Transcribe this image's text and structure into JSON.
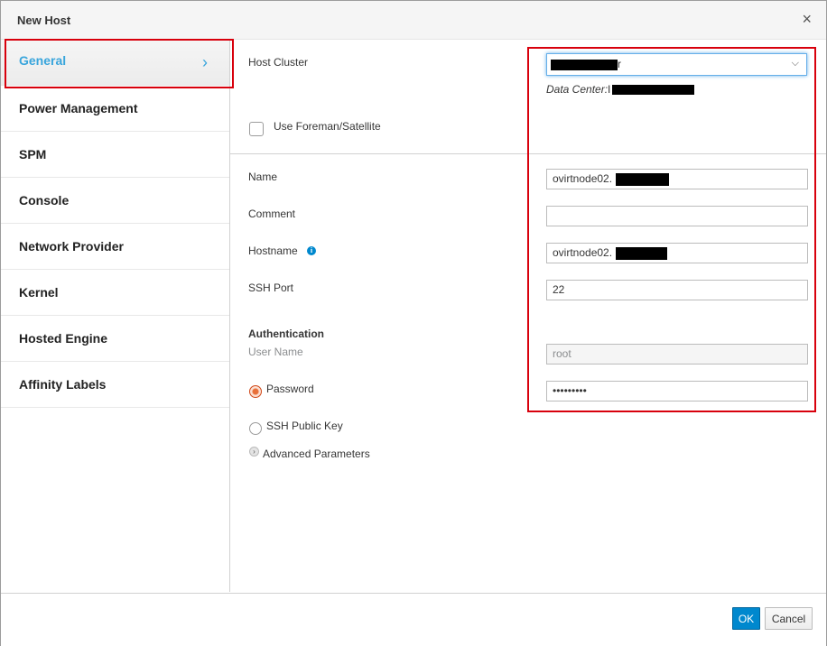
{
  "dialog": {
    "title": "New Host",
    "close_glyph": "×"
  },
  "sidebar": {
    "items": [
      {
        "label": "General",
        "active": true
      },
      {
        "label": "Power Management"
      },
      {
        "label": "SPM"
      },
      {
        "label": "Console"
      },
      {
        "label": "Network Provider"
      },
      {
        "label": "Kernel"
      },
      {
        "label": "Hosted Engine"
      },
      {
        "label": "Affinity Labels"
      }
    ],
    "active_chevron": "›"
  },
  "general": {
    "host_cluster_label": "Host Cluster",
    "host_cluster_value_suffix": "r",
    "data_center_label": "Data Center:",
    "data_center_value_prefix": "I",
    "foreman_label": "Use Foreman/Satellite",
    "name_label": "Name",
    "name_value": "ovirtnode02.",
    "comment_label": "Comment",
    "comment_value": "",
    "hostname_label": "Hostname",
    "hostname_value": "ovirtnode02.",
    "ssh_port_label": "SSH Port",
    "ssh_port_value": "22",
    "authentication_label": "Authentication",
    "username_label": "User Name",
    "username_value": "root",
    "password_label": "Password",
    "password_value": "•••••••••",
    "ssh_key_label": "SSH Public Key",
    "advanced_label": "Advanced Parameters"
  },
  "footer": {
    "ok_label": "OK",
    "cancel_label": "Cancel"
  },
  "colors": {
    "accent": "#39a5dc",
    "primary_button": "#0088ce",
    "highlight_box": "#d8000c",
    "radio_checked": "#e8703a"
  },
  "icons": {
    "close": "close-icon",
    "chevron": "chevron-right-icon",
    "dropdown": "chevron-down-icon",
    "info": "info-icon",
    "expand": "expand-arrow-icon"
  }
}
